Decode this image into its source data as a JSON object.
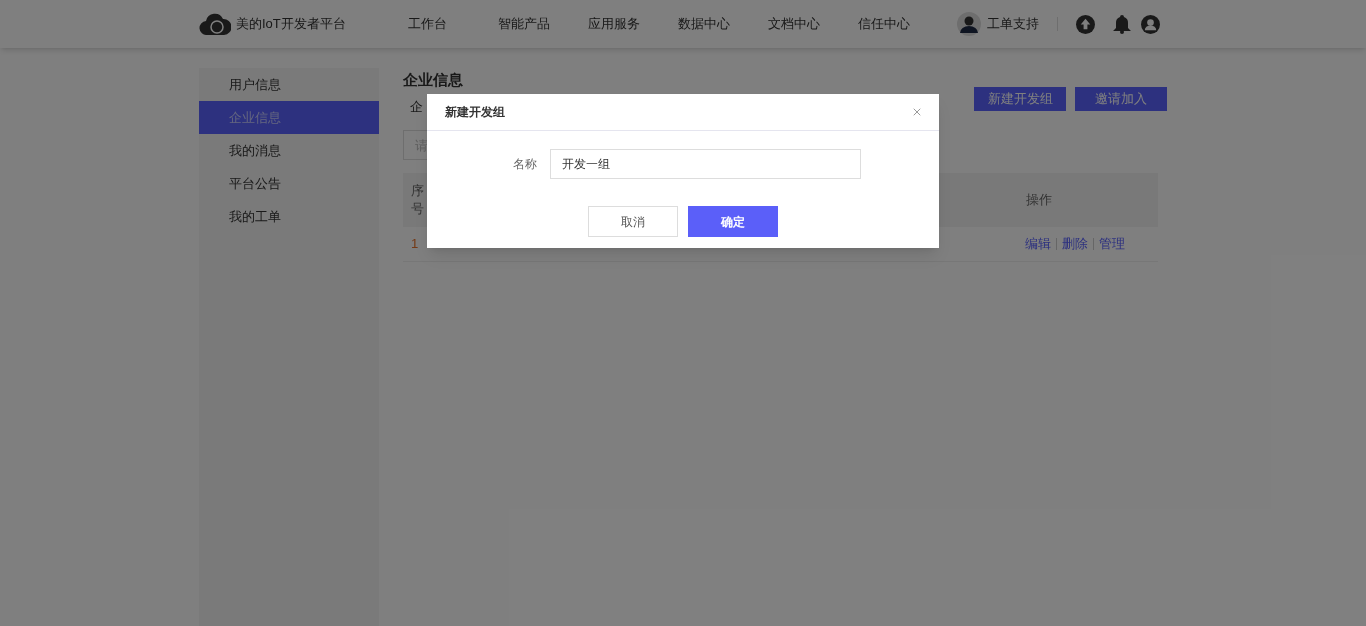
{
  "header": {
    "logo_text": "美的IoT开发者平台",
    "nav": [
      "工作台",
      "智能产品",
      "应用服务",
      "数据中心",
      "文档中心",
      "信任中心"
    ],
    "support": "工单支持"
  },
  "sidebar": {
    "items": [
      {
        "label": "用户信息",
        "selected": false
      },
      {
        "label": "企业信息",
        "selected": true
      },
      {
        "label": "我的消息",
        "selected": false
      },
      {
        "label": "平台公告",
        "selected": false
      },
      {
        "label": "我的工单",
        "selected": false
      }
    ]
  },
  "main": {
    "title": "企业信息",
    "tab_fragment": "企",
    "search_placeholder": "请",
    "buttons": [
      "新建开发组",
      "邀请加入"
    ],
    "table": {
      "columns": [
        "序号",
        "操作"
      ],
      "rows": [
        {
          "index": "1",
          "actions": [
            "编辑",
            "删除",
            "管理"
          ]
        }
      ]
    }
  },
  "dialog": {
    "title": "新建开发组",
    "field": {
      "label": "名称",
      "value": "开发一组"
    },
    "buttons": [
      {
        "label": "取消",
        "kind": "secondary"
      },
      {
        "label": "确定",
        "kind": "primary"
      }
    ]
  }
}
